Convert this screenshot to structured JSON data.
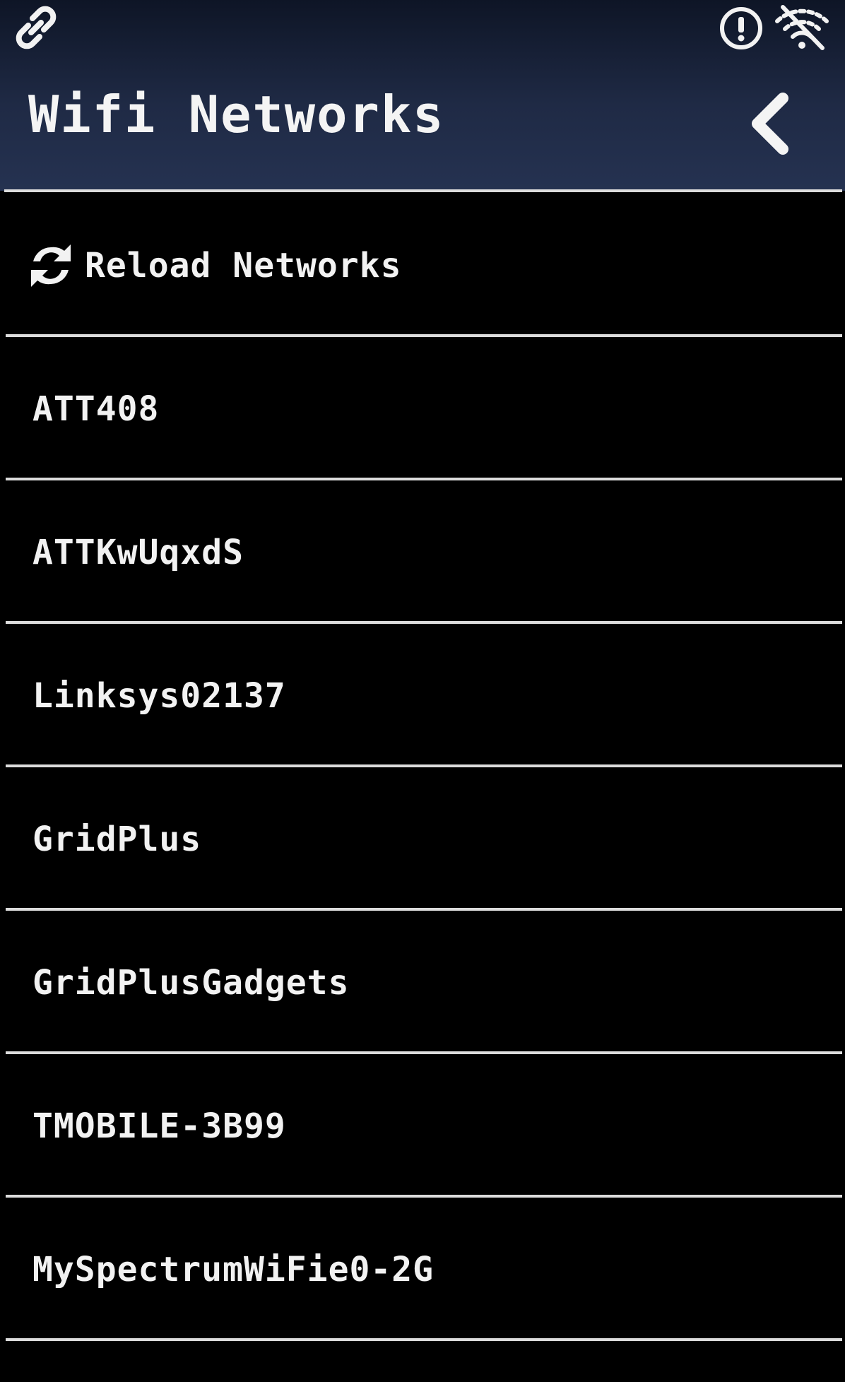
{
  "header": {
    "title": "Wifi Networks",
    "back_icon": "chevron-left-icon"
  },
  "status_bar": {
    "icons": [
      "link-icon",
      "alert-circle-icon",
      "wifi-off-icon"
    ]
  },
  "reload": {
    "label": "Reload Networks",
    "icon": "refresh-icon"
  },
  "networks": [
    "ATT408",
    "ATTKwUqxdS",
    "Linksys02137",
    "GridPlus",
    "GridPlusGadgets",
    "TMOBILE-3B99",
    "MySpectrumWiFie0-2G"
  ],
  "colors": {
    "background": "#000000",
    "header_top": "#0e1526",
    "header_bottom": "#253251",
    "text": "#f2f2f2",
    "divider": "#dcdcdc"
  }
}
